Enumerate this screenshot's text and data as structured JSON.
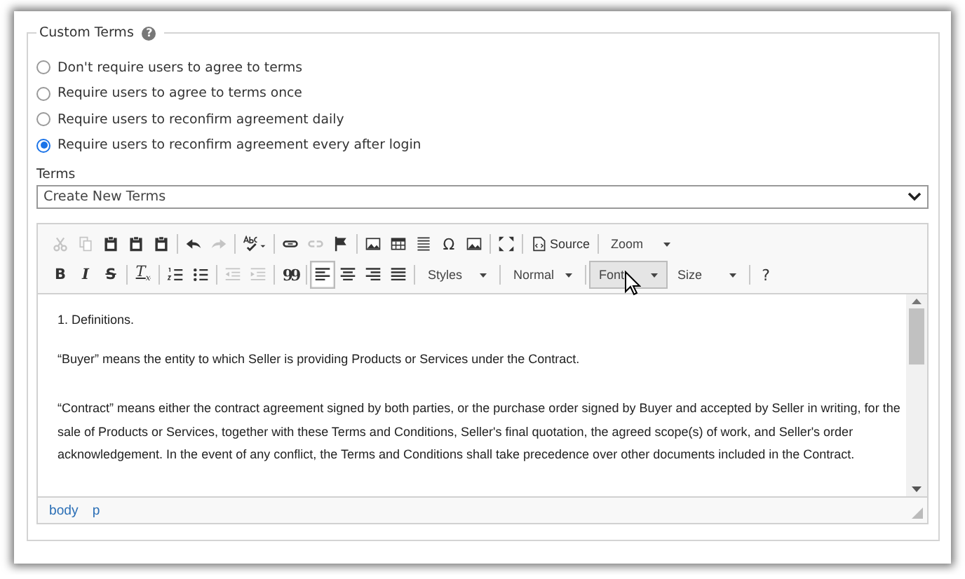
{
  "section": {
    "title": "Custom Terms",
    "help": "?"
  },
  "options": [
    {
      "label": "Don't require users to agree to terms",
      "selected": false
    },
    {
      "label": "Require users to agree to terms once",
      "selected": false
    },
    {
      "label": "Require users to reconfirm agreement daily",
      "selected": false
    },
    {
      "label": "Require users to reconfirm agreement every after login",
      "selected": true
    }
  ],
  "terms": {
    "label": "Terms",
    "value": "Create New Terms"
  },
  "toolbar": [
    [
      {
        "kind": "cut",
        "disabled": true
      },
      {
        "kind": "copy",
        "disabled": true
      },
      {
        "kind": "paste",
        "disabled": false
      },
      {
        "kind": "paste",
        "disabled": false
      },
      {
        "kind": "paste",
        "disabled": false
      },
      {
        "kind": "sep"
      },
      {
        "kind": "undo",
        "disabled": false
      },
      {
        "kind": "redo",
        "disabled": true
      },
      {
        "kind": "sep"
      },
      {
        "kind": "spell",
        "disabled": false
      },
      {
        "kind": "sep"
      },
      {
        "kind": "link",
        "disabled": false
      },
      {
        "kind": "unlink",
        "disabled": true
      },
      {
        "kind": "flag",
        "disabled": false
      },
      {
        "kind": "sep"
      },
      {
        "kind": "image",
        "disabled": false
      },
      {
        "kind": "table",
        "disabled": false
      },
      {
        "kind": "hr",
        "disabled": false
      },
      {
        "kind": "glyph",
        "text": "Ω",
        "disabled": false
      },
      {
        "kind": "image",
        "disabled": false
      },
      {
        "kind": "sep"
      },
      {
        "kind": "maximize",
        "disabled": false
      },
      {
        "kind": "sep"
      },
      {
        "kind": "source",
        "text": "Source",
        "disabled": false
      },
      {
        "kind": "sep"
      },
      {
        "kind": "combo",
        "text": "Zoom",
        "hovered": false
      }
    ],
    [
      {
        "kind": "bold",
        "text": "B",
        "disabled": false
      },
      {
        "kind": "italic",
        "text": "I",
        "disabled": false
      },
      {
        "kind": "strike",
        "text": "S",
        "disabled": false
      },
      {
        "kind": "sep"
      },
      {
        "kind": "clear",
        "text": "T",
        "sub": "x",
        "disabled": false
      },
      {
        "kind": "sep"
      },
      {
        "kind": "numlist",
        "disabled": false
      },
      {
        "kind": "bullist",
        "disabled": false
      },
      {
        "kind": "sep"
      },
      {
        "kind": "outdent",
        "disabled": true
      },
      {
        "kind": "indent",
        "disabled": true
      },
      {
        "kind": "sep"
      },
      {
        "kind": "quote",
        "text": "99",
        "disabled": false
      },
      {
        "kind": "sep"
      },
      {
        "kind": "align",
        "selected": true
      },
      {
        "kind": "center",
        "selected": false
      },
      {
        "kind": "right",
        "selected": false
      },
      {
        "kind": "justify",
        "selected": false
      },
      {
        "kind": "sep"
      },
      {
        "kind": "combo",
        "text": "Styles",
        "hovered": false
      },
      {
        "kind": "sep"
      },
      {
        "kind": "combo",
        "text": "Normal",
        "hovered": false
      },
      {
        "kind": "sep"
      },
      {
        "kind": "combo",
        "text": "Font",
        "hovered": true
      },
      {
        "kind": "combo",
        "text": "Size",
        "hovered": false
      },
      {
        "kind": "sep"
      },
      {
        "kind": "glyph",
        "text": "?",
        "disabled": false
      }
    ]
  ],
  "content": [
    "1. Definitions.",
    "“Buyer” means the entity to which Seller is providing Products or Services under the Contract.",
    "“Contract” means either the contract agreement signed by both parties, or the purchase order signed by Buyer and accepted by Seller in writing, for the sale of Products or Services, together with these Terms and Conditions, Seller's final quotation, the agreed scope(s) of work, and Seller's order acknowledgement. In the event of any conflict, the Terms and Conditions shall take precedence over other documents included in the Contract."
  ],
  "path": [
    "body",
    "p"
  ]
}
